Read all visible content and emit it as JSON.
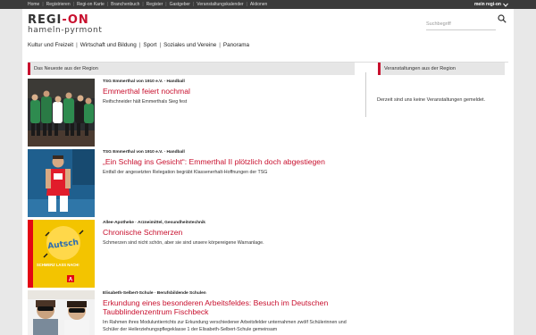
{
  "topnav": {
    "items": [
      "Home",
      "Registrieren",
      "Regi-on Karte",
      "Branchenbuch",
      "Register",
      "Gastgeber",
      "Veranstaltungskalender",
      "Aktionen"
    ],
    "my_region": "mein regi-on"
  },
  "logo": {
    "main_part1": "REGI",
    "main_dash": "-",
    "main_part2": "ON",
    "sub": "hameln-pyrmont"
  },
  "search": {
    "placeholder": "Suchbegriff"
  },
  "mainnav": {
    "items": [
      "Kultur und Freizeit",
      "Wirtschaft und Bildung",
      "Sport",
      "Soziales und Vereine",
      "Panorama"
    ]
  },
  "news": {
    "heading": "Das Neueste aus der Region",
    "articles": [
      {
        "category": "TSG Emmerthal von 1910 e.V. · Handball",
        "title": "Emmerthal feiert nochmal",
        "teaser": "Reifschneider hält Emmerthals Sieg fest"
      },
      {
        "category": "TSG Emmerthal von 1910 e.V. · Handball",
        "title": "„Ein Schlag ins Gesicht“: Emmerthal II plötzlich doch abgestiegen",
        "teaser": "Entfall der angesetzten Relegation begräbt Klassenerhalt-Hoffnungen der TSG"
      },
      {
        "category": "Allee-Apotheke · Arzneimittel, Gesundheitstechnik",
        "title": "Chronische Schmerzen",
        "teaser": "Schmerzen sind nicht schön, aber sie sind unsere körpereigene Warnanlage.",
        "thumb_caption_big": "Autsch",
        "thumb_caption": "SCHMERZ LASS NACH!"
      },
      {
        "category": "Elisabeth-Selbert-Schule · Berufsbildende Schulen",
        "title": "Erkundung eines besonderen Arbeitsfeldes: Besuch im Deutschen Taubblindenzentrum Fischbeck",
        "teaser": "Im Rahmen ihres Moduluntierrichts zur Erkundung verschiedener Arbeitsfelder unternahmen zwölf Schülerinnen und Schüler der Heilerziehungspflegeklasse 1 der Elisabeth-Selbert-Schule gemeinsam"
      }
    ]
  },
  "events": {
    "heading": "Veranstaltungen aus der Region",
    "empty_text": "Derzeit sind uns keine Veranstaltungen gemeldet."
  },
  "colors": {
    "accent": "#c8102e",
    "topbar": "#3b3b3b",
    "background": "#e8e8e8",
    "section_head": "#e6e6e6"
  }
}
